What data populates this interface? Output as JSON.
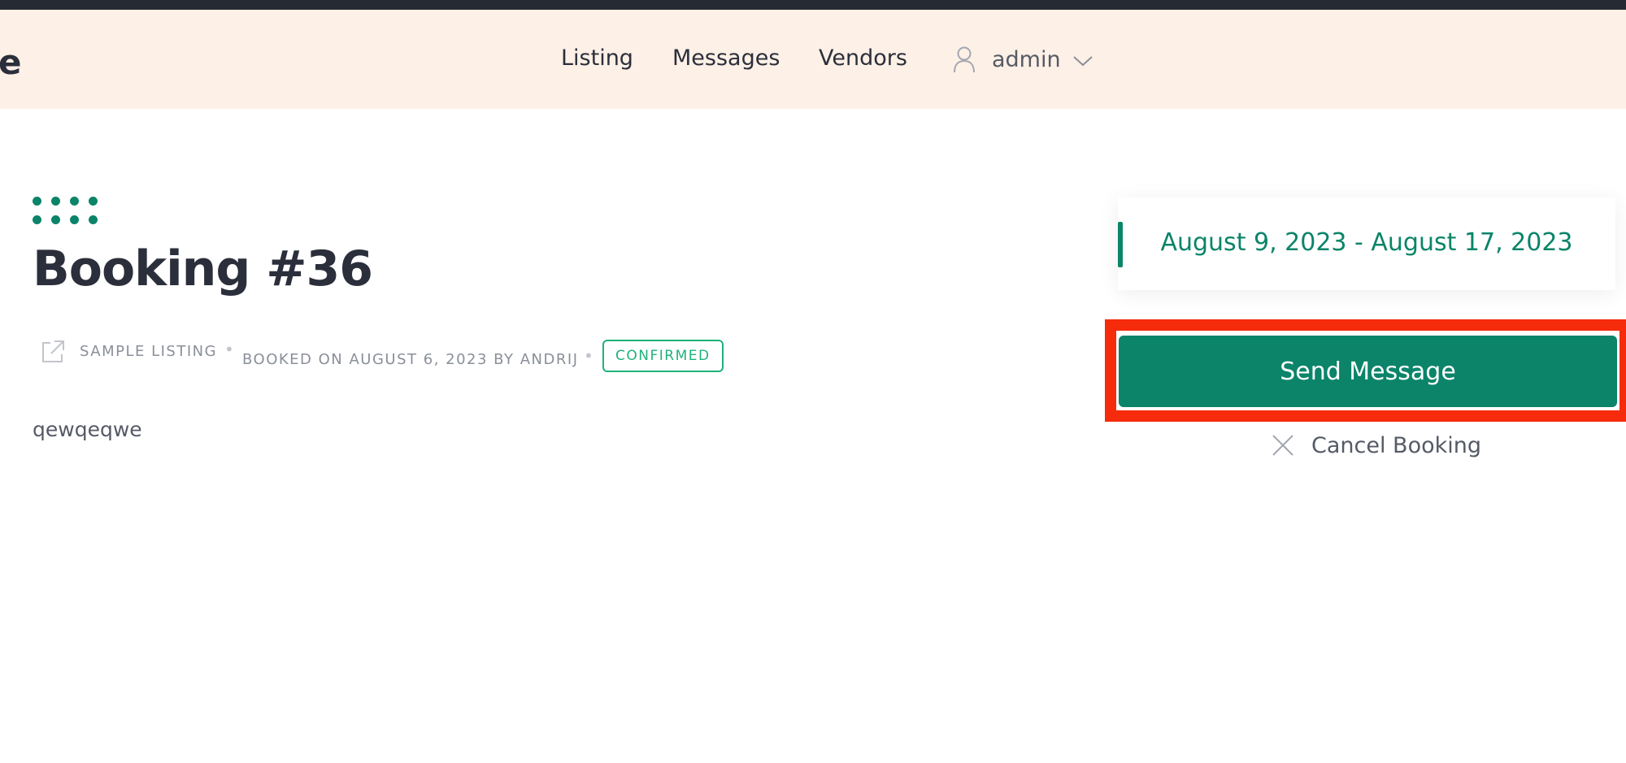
{
  "header": {
    "brand_fragment": "e",
    "nav": [
      {
        "label": "Listing"
      },
      {
        "label": "Messages"
      },
      {
        "label": "Vendors"
      }
    ],
    "user": {
      "name": "admin",
      "icon": "user-icon",
      "dropdown_icon": "chevron-down-icon"
    }
  },
  "main": {
    "decor_icon": "dots-icon",
    "title": "Booking #36",
    "meta": {
      "listing_icon": "external-link-icon",
      "listing": "SAMPLE LISTING",
      "separator": "•",
      "booked": "BOOKED ON AUGUST 6, 2023 BY ANDRIJ",
      "status": "CONFIRMED"
    },
    "description": "qewqeqwe"
  },
  "sidebar": {
    "date_range": "August 9, 2023 - August 17, 2023",
    "send_label": "Send Message",
    "cancel_label": "Cancel Booking",
    "cancel_icon": "close-icon"
  },
  "colors": {
    "accent": "#0b8469",
    "header_bg": "#fdf0e6",
    "status": "#1fb27a",
    "highlight": "#f52b0c",
    "topbar": "#262a33"
  }
}
